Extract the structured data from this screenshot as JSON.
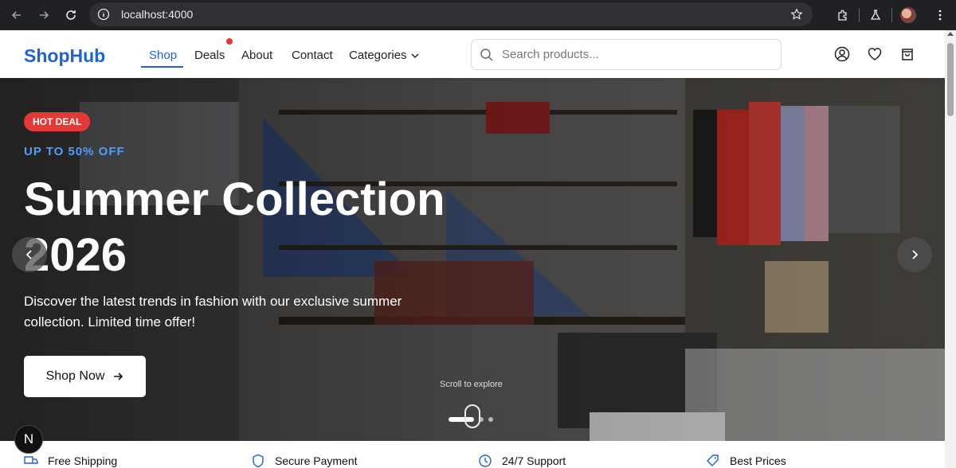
{
  "browser": {
    "url": "localhost:4000"
  },
  "site": {
    "logo": "ShopHub",
    "nav": [
      {
        "label": "Shop"
      },
      {
        "label": "Deals"
      },
      {
        "label": "About"
      },
      {
        "label": "Contact"
      },
      {
        "label": "Categories"
      }
    ],
    "search_placeholder": "Search products..."
  },
  "hero": {
    "badge": "HOT DEAL",
    "kicker": "UP TO 50% OFF",
    "headline": "Summer Collection 2026",
    "description": "Discover the latest trends in fashion with our exclusive summer collection. Limited time offer!",
    "cta": "Shop Now",
    "scroll_hint": "Scroll to explore",
    "slides_total": 3,
    "slide_active": 1
  },
  "fab_label": "N",
  "features": [
    {
      "label": "Free Shipping",
      "icon": "truck-icon"
    },
    {
      "label": "Secure Payment",
      "icon": "shield-icon"
    },
    {
      "label": "24/7 Support",
      "icon": "clock-icon"
    },
    {
      "label": "Best Prices",
      "icon": "tag-icon"
    }
  ],
  "colors": {
    "brand": "#1e63d5",
    "badge": "#e53935",
    "kicker": "#4f9dff"
  }
}
